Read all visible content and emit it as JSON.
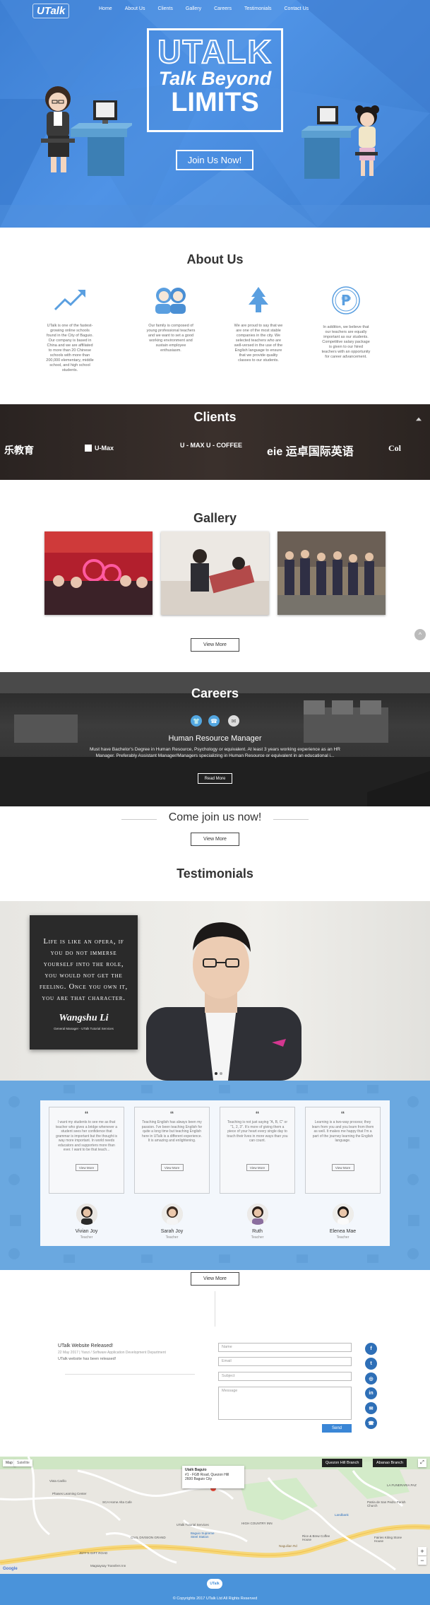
{
  "nav": {
    "logo": "UTalk",
    "items": [
      "Home",
      "About Us",
      "Clients",
      "Gallery",
      "Careers",
      "Testimonials",
      "Contact Us"
    ]
  },
  "hero": {
    "title_line1": "UTALK",
    "title_line2": "Talk Beyond",
    "title_line3": "LIMITS",
    "cta": "Join Us Now!"
  },
  "about": {
    "title": "About Us",
    "columns": [
      {
        "icon": "growth-arrow-icon",
        "text": "UTalk is one of the fastest-growing online schools found in the City of Baguio. Our company is based in China and we are affiliated to more than 20 Chinese schools with more than 200,000 elementary, middle school, and high school students."
      },
      {
        "icon": "people-icon",
        "text": "Our family is composed of young professional teachers and we want to set a good working environment and sustain employee enthusiasm."
      },
      {
        "icon": "pine-tree-icon",
        "text": "We are proud to say that we are one of the most stable companies in the city. We selected teachers who are well-versed in the use of the English language to ensure that we provide quality classes to our students."
      },
      {
        "icon": "peso-icon",
        "text": "In addition, we believe that our teachers are equally important as our students. Competitive salary package is given to our hired teachers with an opportunity for career advancement."
      }
    ]
  },
  "clients": {
    "title": "Clients",
    "logos": [
      "乐教育",
      "U-Max",
      "U - MAX U - COFFEE",
      "eie 运卓国际英语",
      "Col"
    ]
  },
  "gallery": {
    "title": "Gallery",
    "view_more": "View More"
  },
  "careers": {
    "title": "Careers",
    "job_title": "Human Resource Manager",
    "job_desc": "Must have Bachelor's Degree in Human Resource, Psychology or equivalent. At least 3 years working experience as an HR Manager. Preferably Assistant Manager/Managers specializing in Human Resource or equivalent in an educational i...",
    "read_more": "Read More"
  },
  "join": {
    "text": "Come join us now!",
    "view_more": "View More"
  },
  "testimonials": {
    "title": "Testimonials",
    "quote": "Life is like an opera, if you do not immerse yourself into the role, you would not get the feeling. Once you own it, you are that character.",
    "signature": "Wangshu Li",
    "role": "General Manager - UTalk Tutorial Services",
    "cards": [
      {
        "text": "I want my students to see me as that teacher who gives a bridge whenever a student sees her confidence that grammar is important but the thought is way more important. In world needs educators and supporters more than ever. I want to be that teach...",
        "name": "Vivian Joy",
        "role": "Teacher"
      },
      {
        "text": "Teaching English has always been my passion. I've been teaching English for quite a long time but teaching English here in UTalk is a different experience. It is amazing and enlightening.",
        "name": "Sarah Joy",
        "role": "Teacher"
      },
      {
        "text": "Teaching is not just saying \"A, B, C\" or \"1, 2, 3\". It's more of giving them a piece of your heart every single day to touch their lives in more ways than you can count.",
        "name": "Ruth",
        "role": "Teacher"
      },
      {
        "text": "Learning is a two-way process; they learn from you and you learn from them as well. It makes me happy that I'm a part of the journey learning the English language.",
        "name": "Elenea Mae",
        "role": "Teacher"
      }
    ],
    "card_view_more": "View More",
    "view_more": "View More"
  },
  "contact": {
    "news_title": "UTalk Website Released!",
    "news_meta": "22 May 2017 | Yanzi / Software Application Development Department",
    "news_body": "UTalk website has been released!",
    "name_placeholder": "Name",
    "email_placeholder": "Email",
    "subject_placeholder": "Subject",
    "message_placeholder": "Message",
    "send": "Send",
    "social": [
      "facebook-icon",
      "twitter-icon",
      "instagram-icon",
      "linkedin-icon",
      "email-icon",
      "phone-icon"
    ]
  },
  "map": {
    "tab_map": "Map",
    "tab_satellite": "Satellite",
    "branch1": "Quezon Hill Branch",
    "branch2": "Abanao Branch",
    "info_title": "Utalk Baguio",
    "info_addr1": "#1 - FGB Road, Quezon Hill",
    "info_addr2": "2600 Baguio City",
    "labels": [
      "Vista Carillo",
      "Phases Learning Center",
      "SCA Home Alta Cafe",
      "CIVIL DIVISION GRAND",
      "Landbank",
      "Patria de San Pedro Parish Church",
      "LA FUNERARIA PAZ",
      "HIGH COUNTRY INN",
      "UTalk Tutorial Services",
      "Baguio Supreme Steel Station",
      "Rice & Brew Coffee House",
      "JEFF'S GIFT ROAD",
      "Magsaysay Transfers Inn",
      "Fairies Kiting Stone House",
      "Naguilian Rd",
      "Google"
    ]
  },
  "footer": {
    "logo": "UTalk",
    "copyright": "© Copyrights 2017 UTalk Ltd All Rights Reserved"
  }
}
